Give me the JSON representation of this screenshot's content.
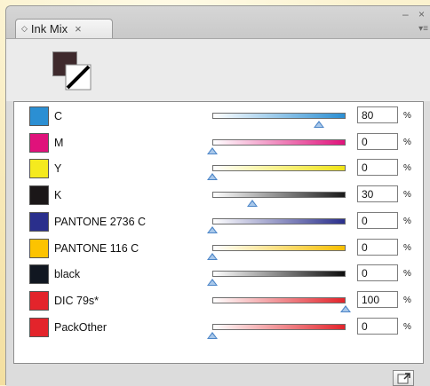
{
  "panel": {
    "tab_label": "Ink Mix",
    "tab_close": "×",
    "tab_diamond": "◇",
    "window_controls": "– ×",
    "menu_icon": "▾≡"
  },
  "swatches": {
    "fill_color": "#3f2a2d",
    "stroke": "none-slash"
  },
  "inks": [
    {
      "name": "C",
      "value": "80",
      "unit": "%",
      "color": "#2b8fd3",
      "gradient_end": "#2b8fd3",
      "level": 0.8
    },
    {
      "name": "M",
      "value": "0",
      "unit": "%",
      "color": "#e0127b",
      "gradient_end": "#e0127b",
      "level": 0.0
    },
    {
      "name": "Y",
      "value": "0",
      "unit": "%",
      "color": "#f5ea1e",
      "gradient_end": "#f0e414",
      "level": 0.0
    },
    {
      "name": "K",
      "value": "30",
      "unit": "%",
      "color": "#1b1718",
      "gradient_end": "#1a1a1a",
      "level": 0.3
    },
    {
      "name": "PANTONE 2736 C",
      "value": "0",
      "unit": "%",
      "color": "#2a2f8c",
      "gradient_end": "#2a2f8c",
      "level": 0.0
    },
    {
      "name": "PANTONE 116 C",
      "value": "0",
      "unit": "%",
      "color": "#fcc300",
      "gradient_end": "#f7bf00",
      "level": 0.0
    },
    {
      "name": "black",
      "value": "0",
      "unit": "%",
      "color": "#111721",
      "gradient_end": "#0d0d0d",
      "level": 0.0
    },
    {
      "name": "DIC 79s*",
      "value": "100",
      "unit": "%",
      "color": "#e3242b",
      "gradient_end": "#e3242b",
      "level": 1.0
    },
    {
      "name": "PackOther",
      "value": "0",
      "unit": "%",
      "color": "#e3242b",
      "gradient_end": "#e3242b",
      "level": 0.0
    }
  ],
  "footer": {
    "new_button_icon": "new-swatch-icon"
  }
}
